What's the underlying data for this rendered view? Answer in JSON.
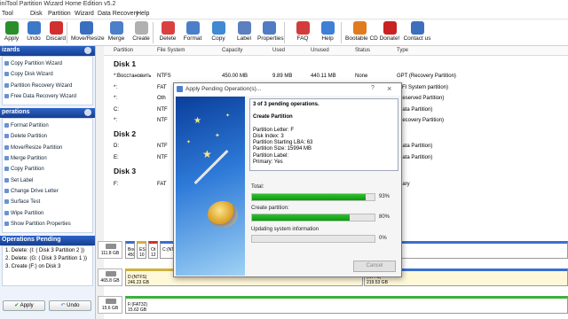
{
  "window": {
    "title": "iniTool Partition Wizard Home Edition v5.2"
  },
  "menu": [
    "Tool",
    "Disk",
    "Partition",
    "Wizard",
    "Data Recovery",
    "Help"
  ],
  "toolbar": [
    {
      "label": "Apply",
      "icon": "apply-check-icon",
      "color": "#2a8f2a"
    },
    {
      "label": "Undo",
      "icon": "undo-arrow-icon",
      "color": "#3c78c8"
    },
    {
      "label": "Discard",
      "icon": "discard-x-icon",
      "color": "#d03030"
    },
    {
      "label": "Move/Resize",
      "icon": "move-resize-icon",
      "color": "#3a6fc0"
    },
    {
      "label": "Merge",
      "icon": "merge-icon",
      "color": "#4c7fc9"
    },
    {
      "label": "Create",
      "icon": "create-icon",
      "color": "#b0b0b0"
    },
    {
      "label": "Delete",
      "icon": "delete-icon",
      "color": "#d94141"
    },
    {
      "label": "Format",
      "icon": "format-icon",
      "color": "#4c7fc9"
    },
    {
      "label": "Copy",
      "icon": "copy-icon",
      "color": "#3f8ad0"
    },
    {
      "label": "Label",
      "icon": "label-icon",
      "color": "#5b7fbf"
    },
    {
      "label": "Properties",
      "icon": "properties-icon",
      "color": "#4f7cc2"
    },
    {
      "label": "FAQ",
      "icon": "faq-icon",
      "color": "#d23c3c"
    },
    {
      "label": "Help",
      "icon": "help-icon",
      "color": "#3f7fd6"
    },
    {
      "label": "Bootable CD",
      "icon": "bootable-cd-icon",
      "color": "#e07b1f"
    },
    {
      "label": "Donate!",
      "icon": "donate-icon",
      "color": "#c82222"
    },
    {
      "label": "Contact us",
      "icon": "contact-icon",
      "color": "#3d6fbd"
    }
  ],
  "sidebar": {
    "wizards_head": "izards",
    "wizards": [
      "Copy Partition Wizard",
      "Copy Disk Wizard",
      "Partition Recovery Wizard",
      "Free Data Recovery Wizard"
    ],
    "operations_head": "perations",
    "operations": [
      "Format Partition",
      "Delete Partition",
      "Move/Resize Partition",
      "Merge Partition",
      "Copy Partition",
      "Set Label",
      "Change Drive Letter",
      "Surface Test",
      "Wipe Partition",
      "Show Partition Properties"
    ],
    "pending_head": "Operations Pending",
    "pending": [
      "1. Delete: (I: ( Disk 3 Partition 2 ))",
      "2. Delete: (G: ( Disk 3 Partition 1 ))",
      "3. Create (F:) on Disk 3"
    ],
    "apply_label": "Apply",
    "undo_label": "Undo"
  },
  "table": {
    "headers": [
      "Partition",
      "File System",
      "Capacity",
      "Used",
      "Unused",
      "Status",
      "Type"
    ],
    "disk1": "Disk 1",
    "disk2": "Disk 2",
    "disk3": "Disk 3",
    "rows1": [
      {
        "p": "*:Восстановить",
        "fs": "NTFS",
        "cap": "450.00 MB",
        "used": "9.89 MB",
        "unused": "440.11 MB",
        "status": "None",
        "type": "GPT (Recovery Partition)"
      },
      {
        "p": "*:",
        "fs": "FAT",
        "cap": "",
        "used": "",
        "unused": "",
        "status": "",
        "type": "(EFI System partition)"
      },
      {
        "p": "*:",
        "fs": "Oth",
        "cap": "",
        "used": "",
        "unused": "",
        "status": "",
        "type": "(Reserved Partition)"
      },
      {
        "p": "C:",
        "fs": "NTF",
        "cap": "",
        "used": "",
        "unused": "",
        "status": "",
        "type": "(Data Partition)"
      },
      {
        "p": "*:",
        "fs": "NTF",
        "cap": "",
        "used": "",
        "unused": "",
        "status": "",
        "type": "(Recovery Partition)"
      }
    ],
    "rows2": [
      {
        "p": "D:",
        "fs": "NTF",
        "type": "(Data Partition)"
      },
      {
        "p": "E:",
        "fs": "NTF",
        "type": "(Data Partition)"
      }
    ],
    "rows3": [
      {
        "p": "F:",
        "fs": "FAT",
        "type": "imary"
      }
    ]
  },
  "diskmap": [
    {
      "size": "111.8 GB",
      "segs": [
        "Boo\n450",
        "ES\n10",
        "Ot\n12",
        "C:(NTFS)"
      ]
    },
    {
      "size": "465.8 GB",
      "segs": [
        "D:(NTFS)\n246.23 GB",
        "(NTFS)\n219.53 GB"
      ]
    },
    {
      "size": "15.6 GB",
      "segs": [
        "F:(FAT32)\n15.62 GB"
      ]
    }
  ],
  "dialog": {
    "title": "Apply Pending Operation(s)...",
    "help": "?",
    "close": "×",
    "lines": [
      "3 of 3 pending operations.",
      "",
      "Create Partition",
      "",
      "Partition Letter: F",
      "Disk Index: 3",
      "Partition Starting LBA: 63",
      "Partition Size: 15994 MB",
      "Partition Label:",
      "Primary: Yes"
    ],
    "total_label": "Total:",
    "total_pct": "93%",
    "total_val": 93,
    "create_label": "Create partition:",
    "create_pct": "80%",
    "create_val": 80,
    "update_label": "Updating system information",
    "update_pct": "0%",
    "update_val": 0,
    "cancel": "Cancel"
  }
}
